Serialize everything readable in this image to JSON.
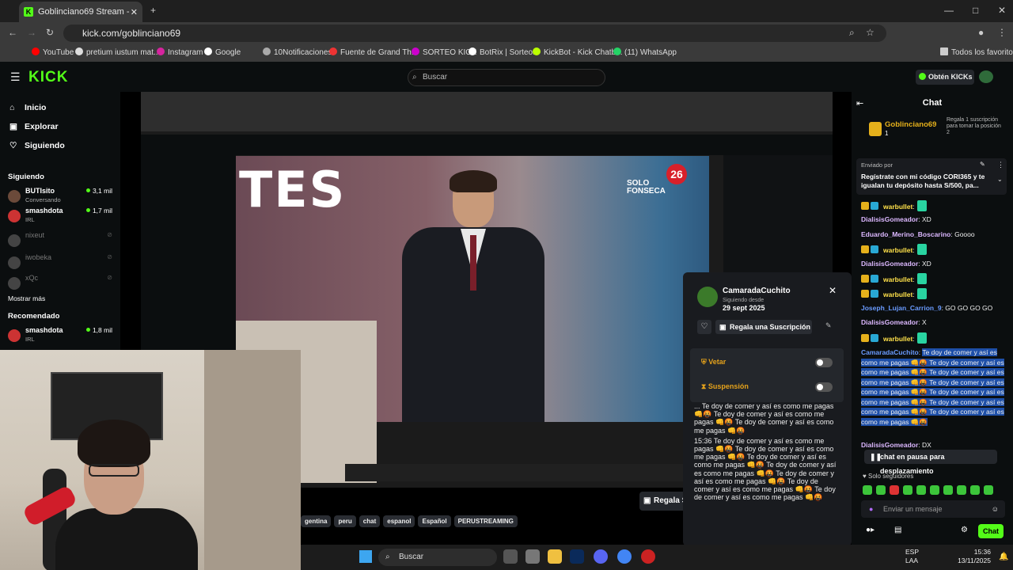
{
  "browser": {
    "tab_title": "Goblinciano69 Stream - Watch",
    "url": "kick.com/goblinciano69",
    "bookmarks": [
      "YouTube",
      "pretium iustum mat...",
      "Instagram",
      "Google",
      "10Notificaciones",
      "Fuente de Grand Th...",
      "SORTEO KICK",
      "BotRix | Sorteos",
      "KickBot - Kick Chatb...",
      "(11) WhatsApp",
      "Todos los favoritos"
    ]
  },
  "header": {
    "logo": "KICK",
    "search_placeholder": "Buscar",
    "get_kicks": "Obtén KICKs"
  },
  "sidebar": {
    "nav": [
      {
        "label": "Inicio"
      },
      {
        "label": "Explorar"
      },
      {
        "label": "Siguiendo"
      }
    ],
    "following_title": "Siguiendo",
    "following": [
      {
        "name": "BUTIsito",
        "sub": "Conversando",
        "viewers": "3,1 mil"
      },
      {
        "name": "smashdota",
        "sub": "IRL",
        "viewers": "1,7 mil"
      },
      {
        "name": "nixeut",
        "sub": "",
        "viewers": ""
      },
      {
        "name": "iwobeka",
        "sub": "",
        "viewers": ""
      },
      {
        "name": "xQc",
        "sub": "",
        "viewers": ""
      }
    ],
    "show_more": "Mostrar más",
    "recommended_title": "Recomendado",
    "recommended": [
      {
        "name": "smashdota",
        "sub": "IRL",
        "viewers": "1,8 mil"
      }
    ]
  },
  "video": {
    "overlay_logo_text": "SOLO FONSECA",
    "overlay_logo_number": "26",
    "banner_text": "TES"
  },
  "tags": [
    "gentina",
    "peru",
    "chat",
    "espanol",
    "Español",
    "PERUSTREAMING"
  ],
  "gift_button": "Regala S",
  "profile_popup": {
    "username": "CamaradaCuchito",
    "following_since_label": "Siguiendo desde",
    "following_since_date": "29 sept 2025",
    "gift_sub": "Regala una Suscripción",
    "veto": "Vetar",
    "suspension": "Suspensión",
    "messages": [
      "... Te doy de comer y así es como me pagas 👊🤬 Te doy de comer y así es como me pagas 👊🤬 Te doy de comer y así es como me pagas 👊🤬",
      "15:36 Te doy de comer y así es como me pagas 👊🤬 Te doy de comer y así es como me pagas 👊🤬 Te doy de comer y así es como me pagas 👊🤬 Te doy de comer y así es como me pagas 👊🤬 Te doy de comer y así es como me pagas 👊🤬 Te doy de comer y así es como me pagas 👊🤬 Te doy de comer y así es como me pagas 👊🤬"
    ]
  },
  "chat": {
    "title": "Chat",
    "top_gifter": {
      "name": "Goblinciano69",
      "count": "1",
      "prompt": "Regala 1 suscripción para tomar la posición 2"
    },
    "pinned": {
      "sent_by": "Enviado por",
      "text": "Regístrate con mi código CORI365 y te igualan tu depósito hasta S/500, pa..."
    },
    "messages": [
      {
        "user": "warbullet",
        "text": ""
      },
      {
        "user": "DialisisGomeador",
        "text": "XD"
      },
      {
        "user": "Eduardo_Merino_Boscarino",
        "text": "Goooo"
      },
      {
        "user": "warbullet",
        "text": ""
      },
      {
        "user": "DialisisGomeador",
        "text": "XD"
      },
      {
        "user": "warbullet",
        "text": ""
      },
      {
        "user": "warbullet",
        "text": ""
      },
      {
        "user": "Joseph_Lujan_Carrion_9",
        "text": "GO GO GO GO"
      },
      {
        "user": "DialisisGomeador",
        "text": "X"
      },
      {
        "user": "warbullet",
        "text": ""
      },
      {
        "user": "CamaradaCuchito",
        "text": "Te doy de comer y así es como me pagas 👊🤬 Te doy de comer y así es como me pagas 👊🤬 Te doy de comer y así es como me pagas 👊🤬 Te doy de comer y así es como me pagas 👊🤬 Te doy de comer y así es como me pagas 👊🤬 Te doy de comer y así es como me pagas 👊🤬 Te doy de comer y así es como me pagas 👊🤬"
      },
      {
        "user": "DialisisGomeador",
        "text": "DX"
      }
    ],
    "paused": "chat en pausa para desplazamiento",
    "followers_only": "Solo seguidores",
    "input_placeholder": "Enviar un mensaje",
    "send": "Chat"
  },
  "taskbar": {
    "search": "Buscar",
    "lang": "ESP",
    "lang2": "LAA",
    "time": "15:36",
    "date": "13/11/2025"
  },
  "colors": {
    "kick_green": "#53fc18",
    "gold": "#e5b01b",
    "highlight": "#1e4fa8"
  }
}
